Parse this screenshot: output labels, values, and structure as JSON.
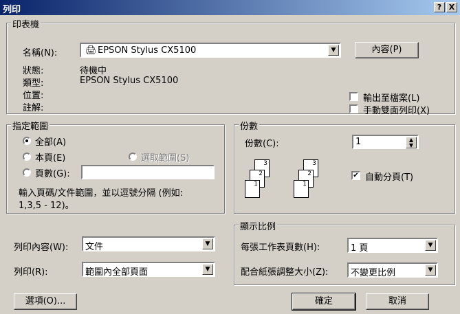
{
  "window": {
    "title": "列印",
    "help_label": "?",
    "close_label": "X"
  },
  "printer": {
    "group_label": "印表機",
    "name_label": "名稱(N):",
    "name_value": "EPSON Stylus CX5100",
    "properties_button": "內容(P)",
    "status_label": "狀態:",
    "status_value": "待機中",
    "type_label": "類型:",
    "type_value": "EPSON Stylus CX5100",
    "where_label": "位置:",
    "comment_label": "註解:",
    "print_to_file": "輸出至檔案(L)",
    "manual_duplex": "手動雙面列印(X)"
  },
  "range": {
    "group_label": "指定範圍",
    "all": "全部(A)",
    "current": "本頁(E)",
    "selection": "選取範圍(S)",
    "pages": "頁數(G):",
    "hint_line1": "輸入頁碼/文件範圍，並以逗號分隔 (例如:",
    "hint_line2": "1,3,5 - 12)。"
  },
  "copies": {
    "group_label": "份數",
    "copies_label": "份數(C):",
    "copies_value": "1",
    "collate": "自動分頁(T)",
    "page_numbers": [
      "3",
      "2",
      "1",
      "3",
      "2",
      "1"
    ]
  },
  "zoom": {
    "group_label": "顯示比例",
    "pages_per_sheet_label": "每張工作表頁數(H):",
    "pages_per_sheet_value": "1 頁",
    "scale_label": "配合紙張調整大小(Z):",
    "scale_value": "不變更比例"
  },
  "print_what": {
    "label": "列印內容(W):",
    "value": "文件"
  },
  "print": {
    "label": "列印(R):",
    "value": "範圍內全部頁面"
  },
  "buttons": {
    "options": "選項(O)...",
    "ok": "確定",
    "cancel": "取消"
  }
}
